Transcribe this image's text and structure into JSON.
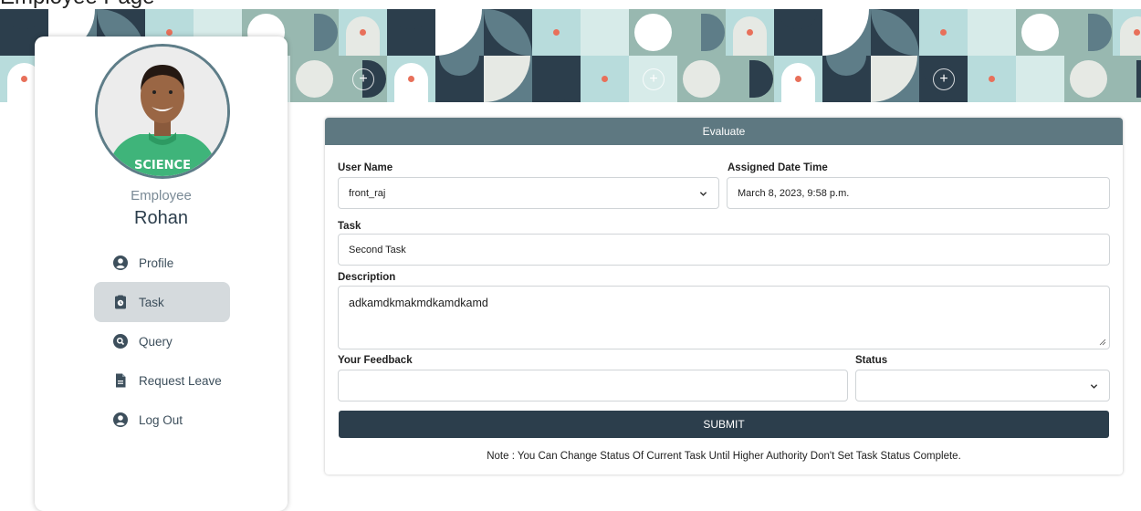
{
  "page": {
    "title": "Employee Page"
  },
  "colors": {
    "primary_dark": "#2c3e4c",
    "header_teal": "#5e7881",
    "accent_dot": "#e8705a",
    "active_nav": "#d5dadd"
  },
  "profile": {
    "role": "Employee",
    "name": "Rohan"
  },
  "nav": [
    {
      "label": "Profile",
      "icon": "user-circle-icon",
      "active": false
    },
    {
      "label": "Task",
      "icon": "clipboard-icon",
      "active": true
    },
    {
      "label": "Query",
      "icon": "search-circle-icon",
      "active": false
    },
    {
      "label": "Request Leave",
      "icon": "file-icon",
      "active": false
    },
    {
      "label": "Log Out",
      "icon": "user-circle-icon",
      "active": false
    }
  ],
  "form": {
    "header": "Evaluate",
    "user_name": {
      "label": "User Name",
      "value": "front_raj"
    },
    "assigned": {
      "label": "Assigned Date Time",
      "value": "March 8, 2023, 9:58 p.m."
    },
    "task": {
      "label": "Task",
      "value": "Second Task"
    },
    "description": {
      "label": "Description",
      "value": "adkamdkmakmdkamdkamd"
    },
    "feedback": {
      "label": "Your Feedback",
      "value": ""
    },
    "status": {
      "label": "Status",
      "value": ""
    },
    "submit_label": "SUBMIT",
    "note": "Note : You Can Change Status Of Current Task Until Higher Authority Don't Set Task Status Complete."
  }
}
